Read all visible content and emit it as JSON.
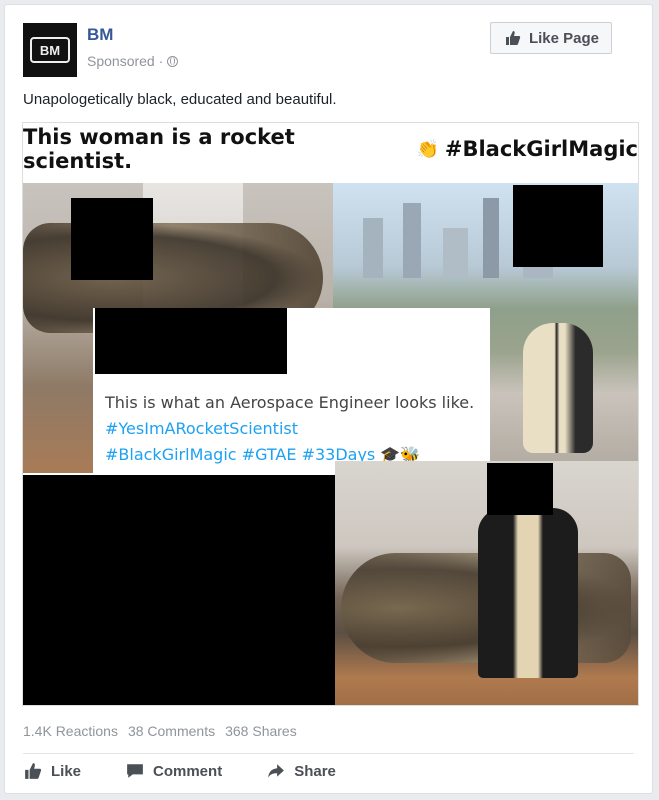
{
  "post": {
    "page_name": "BM",
    "avatar_text": "BM",
    "sponsored": "Sponsored ·",
    "like_page": "Like Page",
    "caption": "Unapologetically black, educated and beautiful."
  },
  "image": {
    "headline": "This woman is a rocket scientist.",
    "headline_tag": "#BlackGirlMagic",
    "tweet_text": "This is what an Aerospace Engineer looks like.",
    "tweet_tag1": "#YesImARocketScientist",
    "tweet_tag2": "#BlackGirlMagic #GTAE #33Days"
  },
  "stats": {
    "reactions": "1.4K Reactions",
    "comments": "38 Comments",
    "shares": "368 Shares"
  },
  "actions": {
    "like": "Like",
    "comment": "Comment",
    "share": "Share"
  },
  "icons": {
    "like": "thumbs-up-icon",
    "comment": "speech-bubble-icon",
    "share": "share-arrow-icon",
    "globe": "globe-icon"
  }
}
